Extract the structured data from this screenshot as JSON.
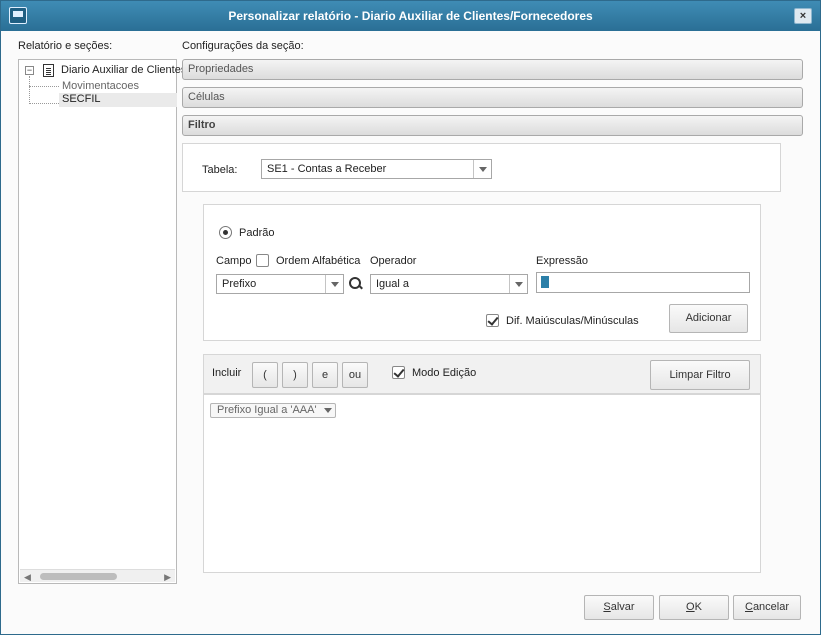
{
  "window": {
    "title": "Personalizar relatório - Diario Auxiliar de Clientes/Fornecedores",
    "close_label": "×"
  },
  "left": {
    "label": "Relatório e seções:",
    "tree": {
      "root": "Diario Auxiliar de Clientes",
      "expander": "−",
      "children": [
        "Movimentacoes",
        "SECFIL"
      ],
      "selected": "SECFIL"
    },
    "scroll_left": "◀",
    "scroll_right": "▶"
  },
  "config": {
    "label": "Configurações da seção:",
    "sections": [
      "Propriedades",
      "Células",
      "Filtro"
    ],
    "active_section": "Filtro"
  },
  "filter": {
    "table_label": "Tabela:",
    "table_value": "SE1 - Contas a Receber",
    "mode_label": "Padrão",
    "field_label": "Campo",
    "alpha_order_label": "Ordem Alfabética",
    "field_value": "Prefixo",
    "operator_label": "Operador",
    "operator_value": "Igual a",
    "expression_label": "Expressão",
    "expression_value": "",
    "case_sensitive_label": "Dif. Maiúsculas/Minúsculas",
    "case_sensitive_checked": true,
    "add_button": "Adicionar",
    "include_label": "Incluir",
    "op_buttons": [
      "(",
      ")",
      "e",
      "ou"
    ],
    "edit_mode_label": "Modo Edição",
    "edit_mode_checked": true,
    "clear_button": "Limpar Filtro",
    "expression_chip": "Prefixo Igual a 'AAA'"
  },
  "footer": {
    "save": "Salvar",
    "ok": "OK",
    "cancel": "Cancelar"
  }
}
